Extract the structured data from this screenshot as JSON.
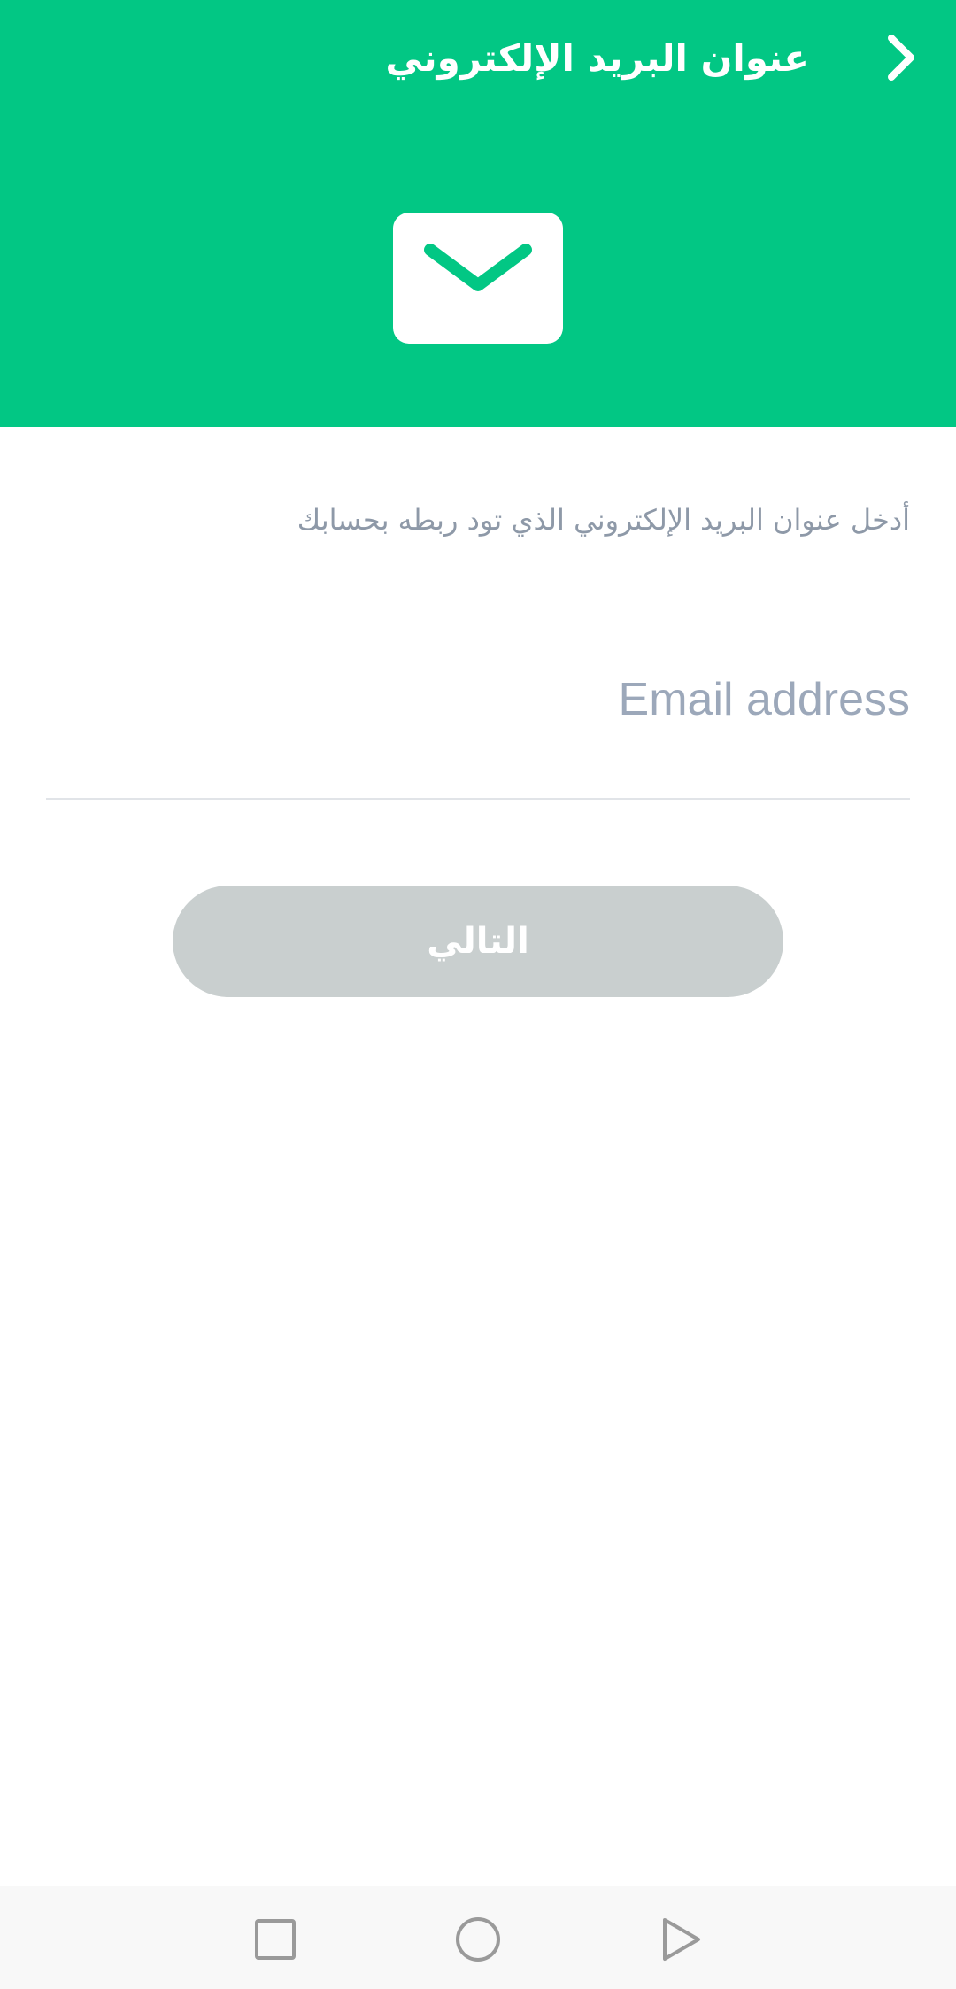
{
  "colors": {
    "accent": "#02C784",
    "button_disabled": "#C9CFCF",
    "hint_text": "#8E99A8",
    "placeholder": "#9CA8BA"
  },
  "header": {
    "title": "عنوان البريد الإلكتروني",
    "back_icon": "chevron-right-icon",
    "hero_icon": "envelope-icon"
  },
  "form": {
    "hint": "أدخل عنوان البريد الإلكتروني الذي تود ربطه بحسابك",
    "email_placeholder": "Email address",
    "email_value": "",
    "next_label": "التالي"
  },
  "navbar": {
    "recents_icon": "square-icon",
    "home_icon": "circle-icon",
    "back_icon": "triangle-back-icon"
  }
}
